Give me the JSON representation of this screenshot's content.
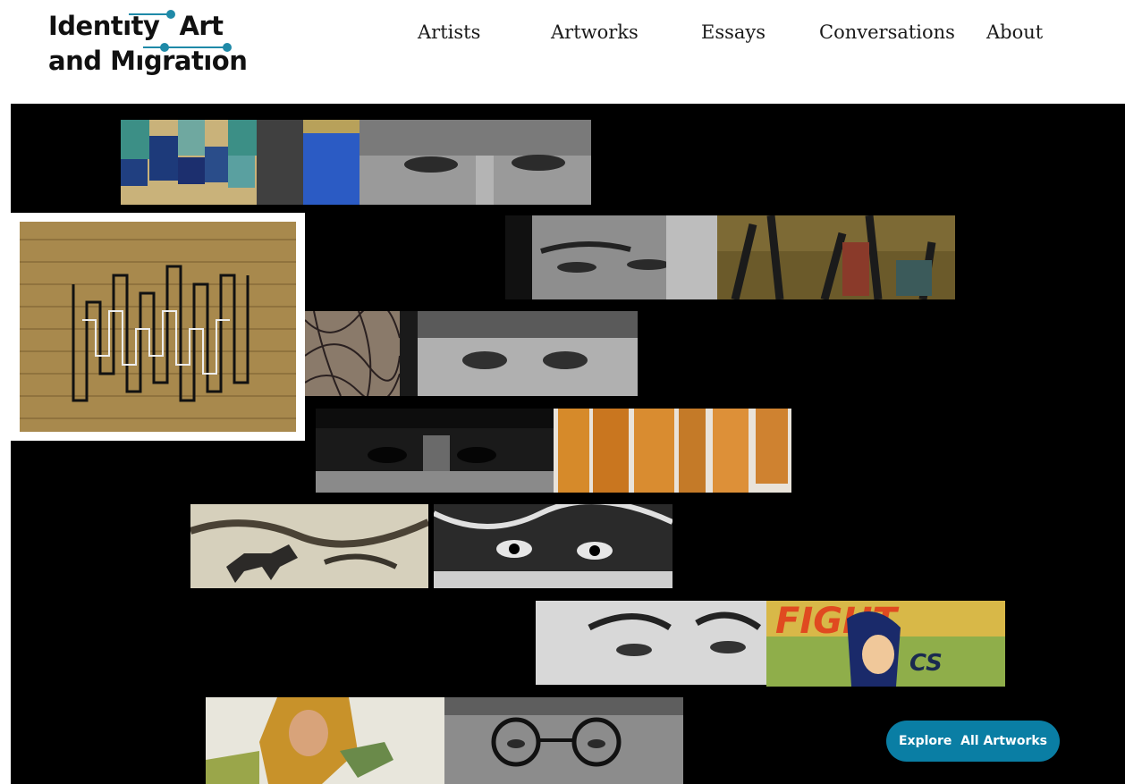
{
  "logo": {
    "line1_a": "Identıty",
    "line1_b": "Art",
    "line2": "and Mıgratıon",
    "accent_color": "#1f8aa8"
  },
  "nav": {
    "items": [
      {
        "label": "Artists"
      },
      {
        "label": "Artworks"
      },
      {
        "label": "Essays"
      },
      {
        "label": "Conversations"
      },
      {
        "label": "About"
      }
    ]
  },
  "gallery": {
    "background": "#000000",
    "rows": [
      {
        "artwork": "abstract-weaving-blue-squares",
        "portrait": "artist-eyes-portrait-1"
      },
      {
        "portrait": "artist-eyes-portrait-2",
        "artwork": "expressionist-landscape-painting"
      },
      {
        "artwork": "ink-scribble-drawing",
        "portrait": "artist-eyes-portrait-3"
      },
      {
        "portrait": "artist-eyes-portrait-4",
        "artwork": "amber-panels-sculpture"
      },
      {
        "artwork": "animal-etching",
        "portrait": "artist-eyes-portrait-5"
      },
      {
        "portrait": "artist-eyes-portrait-6",
        "artwork": "comic-book-cover"
      },
      {
        "artwork": "aviator-illustration",
        "portrait": "artist-eyes-portrait-7-glasses"
      }
    ],
    "featured": "woven-textile-with-black-white-lines"
  },
  "cta": {
    "label": "Explore  All Artworks",
    "color": "#0a7ea4"
  }
}
